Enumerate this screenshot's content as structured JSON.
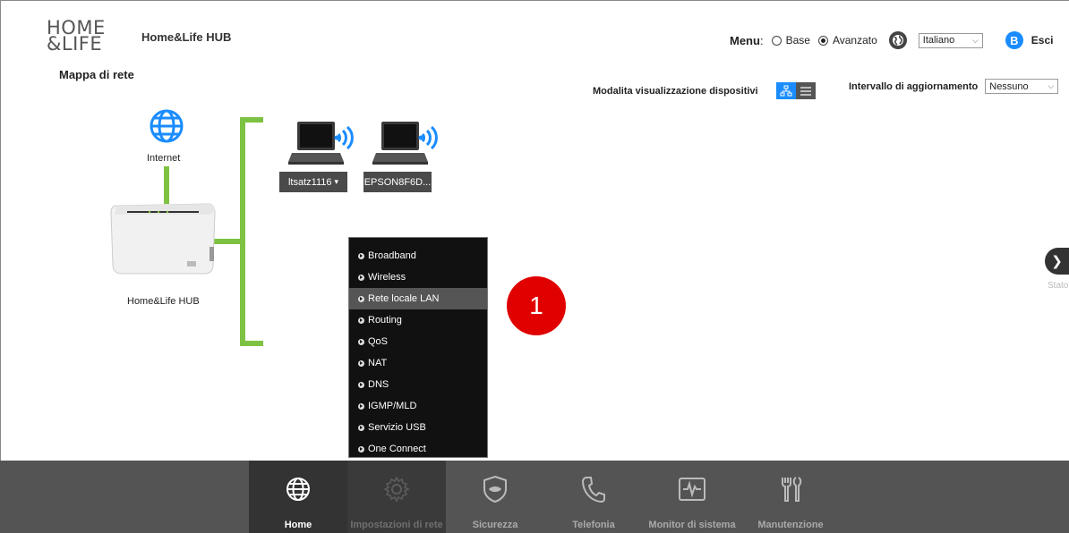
{
  "header": {
    "logo_line1": "HOME",
    "logo_line2": "&LIFE",
    "app_title": "Home&Life HUB",
    "menu_label": "Menu",
    "menu_separator": ":",
    "mode_base": "Base",
    "mode_advanced": "Avanzato",
    "mode_selected": "Avanzato",
    "language": "Italiano",
    "exit_label": "Esci",
    "exit_icon_letter": "B"
  },
  "page": {
    "title": "Mappa di rete",
    "view_mode_label": "Modalita visualizzazione dispositivi",
    "refresh_label": "Intervallo di aggiornamento",
    "refresh_value": "Nessuno"
  },
  "map": {
    "internet_label": "Internet",
    "router_label": "Home&Life HUB",
    "devices": [
      {
        "name": "ltsatz1116",
        "caret": "▾"
      },
      {
        "name": "EPSON8F6D..."
      }
    ]
  },
  "context_menu": {
    "items": [
      {
        "label": "Broadband"
      },
      {
        "label": "Wireless"
      },
      {
        "label": "Rete locale LAN",
        "highlighted": true
      },
      {
        "label": "Routing"
      },
      {
        "label": "QoS"
      },
      {
        "label": "NAT"
      },
      {
        "label": "DNS"
      },
      {
        "label": "IGMP/MLD"
      },
      {
        "label": "Servizio USB"
      },
      {
        "label": "One Connect"
      }
    ]
  },
  "annotation": {
    "number": "1",
    "color": "#e00000"
  },
  "side_panel": {
    "label": "Stato"
  },
  "bottom_nav": [
    {
      "label": "Home",
      "icon": "globe-icon",
      "active": true
    },
    {
      "label": "Impostazioni di rete",
      "icon": "gear-icon"
    },
    {
      "label": "Sicurezza",
      "icon": "shield-icon"
    },
    {
      "label": "Telefonia",
      "icon": "phone-icon"
    },
    {
      "label": "Monitor di sistema",
      "icon": "monitor-icon"
    },
    {
      "label": "Manutenzione",
      "icon": "tools-icon"
    }
  ],
  "colors": {
    "accent": "#1a8cff",
    "link_line": "#7dc242",
    "bottom_bar": "#545454"
  }
}
